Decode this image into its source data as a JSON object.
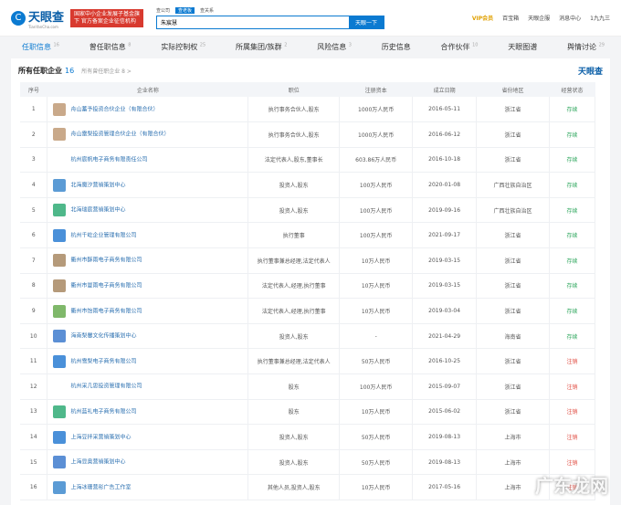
{
  "header": {
    "logo": "天眼查",
    "logo_sub": "TianYanCha.com",
    "banner": "国家中小企业发展子基金旗下 官方备案企业征信机构",
    "search_tabs": [
      "查公司",
      "查老板",
      "查关系"
    ],
    "search_value": "朱宸慧",
    "search_button": "天眼一下",
    "nav": [
      "VIP会员",
      "百宝箱",
      "天眼企服",
      "消息中心",
      "1九九三"
    ]
  },
  "tabs": [
    {
      "label": "任职信息",
      "count": "16"
    },
    {
      "label": "曾任职信息",
      "count": "8"
    },
    {
      "label": "实际控制权",
      "count": "25"
    },
    {
      "label": "所属集团/族群",
      "count": "2"
    },
    {
      "label": "风险信息",
      "count": "3"
    },
    {
      "label": "历史信息",
      "count": ""
    },
    {
      "label": "合作伙伴",
      "count": "10"
    },
    {
      "label": "天眼图谱",
      "count": ""
    },
    {
      "label": "舆情讨论",
      "count": "29"
    }
  ],
  "section": {
    "title": "所有任职企业",
    "count": "16",
    "past": "所有曾任职企业 8 >",
    "brand": "天眼查"
  },
  "columns": [
    "序号",
    "企业名称",
    "职位",
    "注册资本",
    "成立日期",
    "省份地区",
    "经营状态"
  ],
  "rows": [
    [
      "1",
      "舟山蓄予投资合伙企业（有限合伙）",
      "执行事务合伙人,股东",
      "1000万人民币",
      "2016-05-11",
      "浙江省",
      "存续"
    ],
    [
      "2",
      "舟山雷梨投资管理合伙企业（有限合伙）",
      "执行事务合伙人,股东",
      "1000万人民币",
      "2016-06-12",
      "浙江省",
      "存续"
    ],
    [
      "3",
      "杭州宸帆电子商务有限责任公司",
      "法定代表人,股东,董事长",
      "603.86万人民币",
      "2016-10-18",
      "浙江省",
      "存续"
    ],
    [
      "4",
      "北海魔汐营销策划中心",
      "投资人,股东",
      "100万人民币",
      "2020-01-08",
      "广西壮族自治区",
      "存续"
    ],
    [
      "5",
      "北海瑞宸营销策划中心",
      "投资人,股东",
      "100万人民币",
      "2019-09-16",
      "广西壮族自治区",
      "存续"
    ],
    [
      "6",
      "杭州千屹企业管理有限公司",
      "执行董事",
      "100万人民币",
      "2021-09-17",
      "浙江省",
      "存续"
    ],
    [
      "7",
      "衢州市酥雨电子商务有限公司",
      "执行董事兼总经理,法定代表人",
      "10万人民币",
      "2019-03-15",
      "浙江省",
      "存续"
    ],
    [
      "8",
      "衢州市曼雨电子商务有限公司",
      "法定代表人,经理,执行董事",
      "10万人民币",
      "2019-03-15",
      "浙江省",
      "存续"
    ],
    [
      "9",
      "衢州市饴雨电子商务有限公司",
      "法定代表人,经理,执行董事",
      "10万人民币",
      "2019-03-04",
      "浙江省",
      "存续"
    ],
    [
      "10",
      "海南梨馨文化传播策划中心",
      "投资人,股东",
      "-",
      "2021-04-29",
      "海南省",
      "存续"
    ],
    [
      "11",
      "杭州雪梨电子商务有限公司",
      "执行董事兼总经理,法定代表人",
      "50万人民币",
      "2016-10-25",
      "浙江省",
      "注销"
    ],
    [
      "12",
      "杭州采几思投资管理有限公司",
      "股东",
      "100万人民币",
      "2015-09-07",
      "浙江省",
      "注销"
    ],
    [
      "13",
      "杭州蓝礼电子商务有限公司",
      "股东",
      "10万人民币",
      "2015-06-02",
      "浙江省",
      "注销"
    ],
    [
      "14",
      "上海豆拌采营销策划中心",
      "投资人,股东",
      "50万人民币",
      "2019-08-13",
      "上海市",
      "注销"
    ],
    [
      "15",
      "上海显奥营销策划中心",
      "投资人,股东",
      "50万人民币",
      "2019-08-13",
      "上海市",
      "注销"
    ],
    [
      "16",
      "上海冰珊营彤广告工作室",
      "其他人员,投资人,股东",
      "10万人民币",
      "2017-05-16",
      "上海市",
      "注销"
    ]
  ],
  "icon_colors": [
    "#c9a98a",
    "#c9a98a",
    "#ffffff",
    "#5b9bd5",
    "#4fb88a",
    "#4a90d9",
    "#b59a7a",
    "#b59a7a",
    "#7fb86a",
    "#5b8fd5",
    "#4a90d9",
    "#ffffff",
    "#4fb88a",
    "#4a90d9",
    "#5b8fd5",
    "#5b9bd5"
  ],
  "watermark": "广东龙网"
}
